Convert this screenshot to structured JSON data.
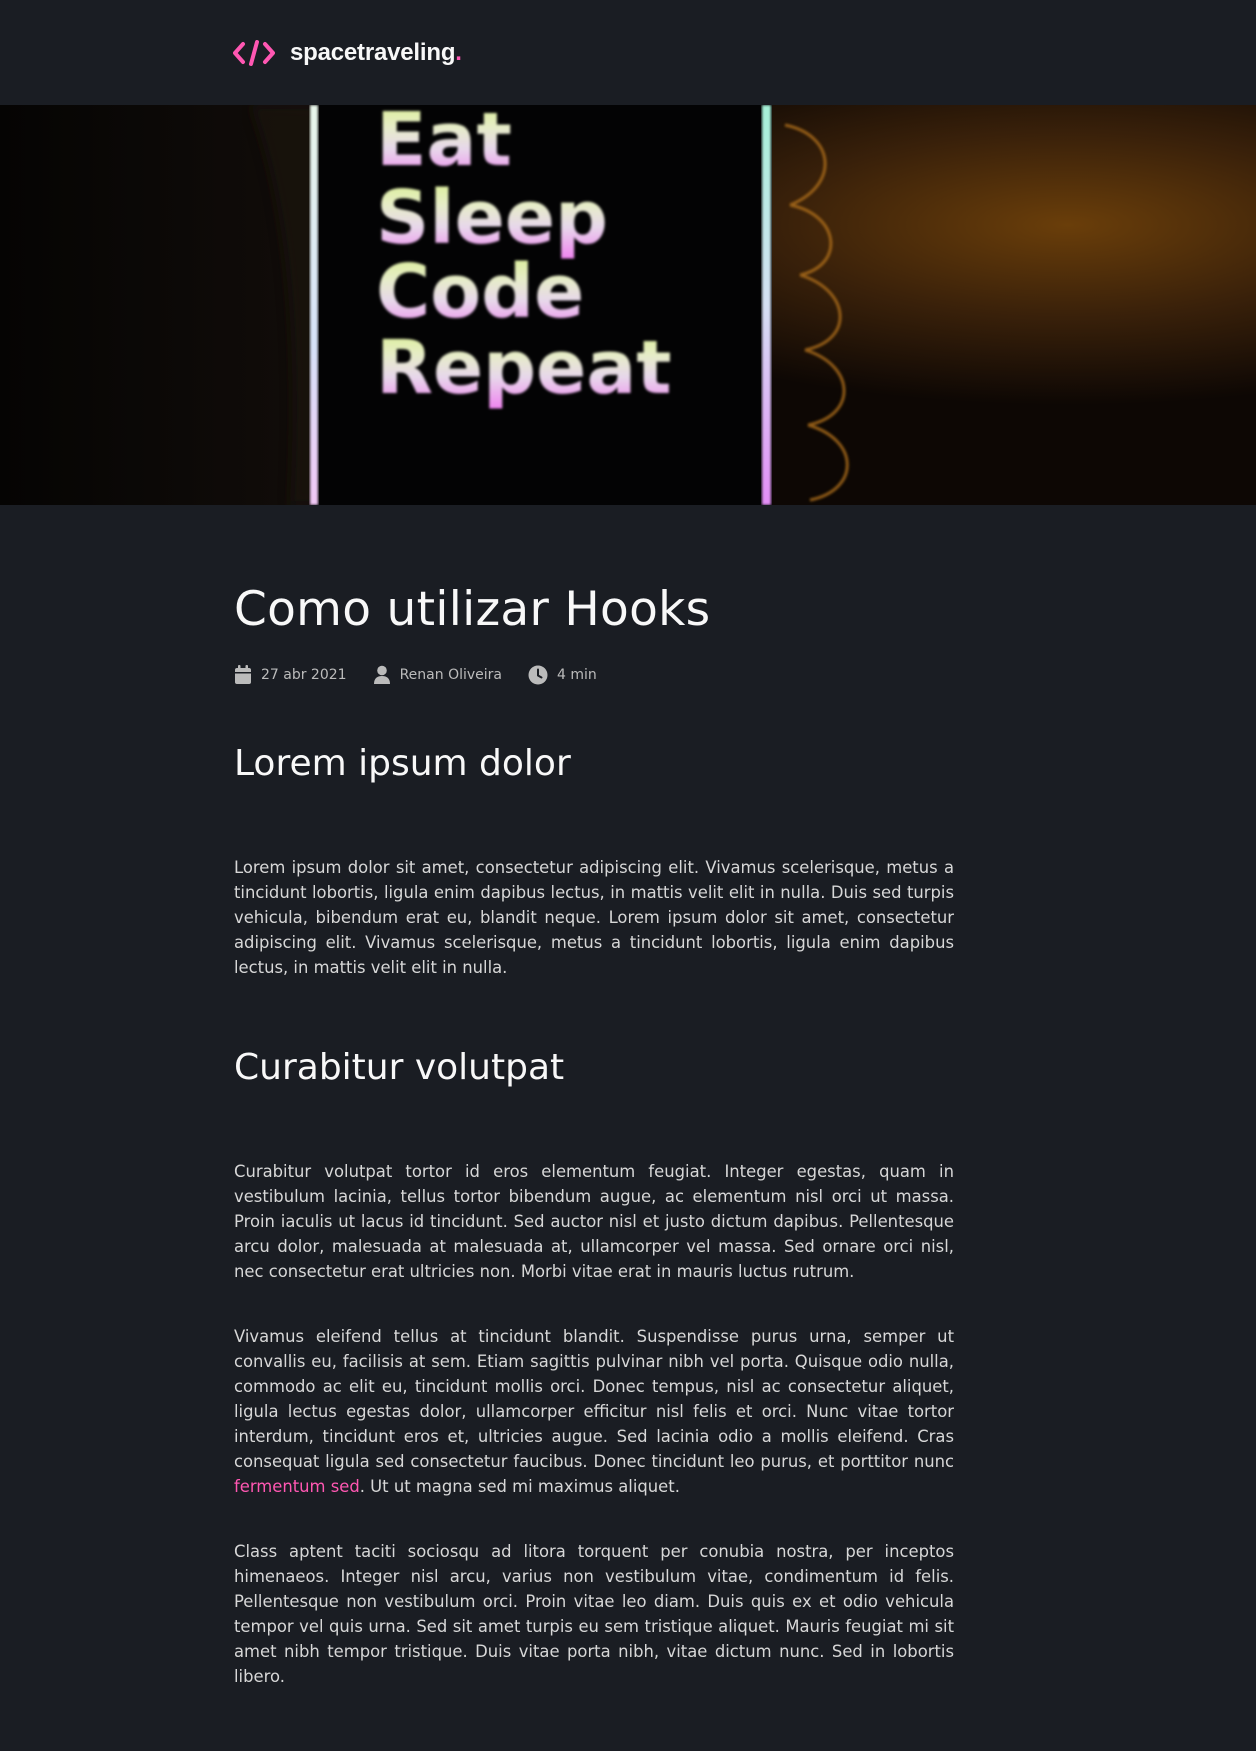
{
  "header": {
    "logo_text": "spacetraveling",
    "logo_dot": ".",
    "accent_color": "#ff57b2",
    "logo_icon": "code-icon"
  },
  "banner": {
    "lines": [
      "Eat",
      "Sleep",
      "Code",
      "Repeat"
    ]
  },
  "post": {
    "title": "Como utilizar Hooks",
    "date": "27 abr 2021",
    "author": "Renan Oliveira",
    "reading_time": "4 min",
    "icons": [
      "calendar-icon",
      "user-icon",
      "clock-icon"
    ],
    "sections": [
      {
        "heading": "Lorem ipsum dolor",
        "paragraphs": [
          {
            "text": "Lorem ipsum dolor sit amet, consectetur adipiscing elit. Vivamus scelerisque, metus a tincidunt lobortis, ligula enim dapibus lectus, in mattis velit elit in nulla. Duis sed turpis vehicula, bibendum erat eu, blandit neque. Lorem ipsum dolor sit amet, consectetur adipiscing elit. Vivamus scelerisque, metus a tincidunt lobortis, ligula enim dapibus lectus, in mattis velit elit in nulla."
          }
        ]
      },
      {
        "heading": "Curabitur volutpat",
        "paragraphs": [
          {
            "text": "Curabitur volutpat tortor id eros elementum feugiat. Integer egestas, quam in vestibulum lacinia, tellus tortor bibendum augue, ac elementum nisl orci ut massa. Proin iaculis ut lacus id tincidunt. Sed auctor nisl et justo dictum dapibus. Pellentesque arcu dolor, malesuada at malesuada at, ullamcorper vel massa. Sed ornare orci nisl, nec consectetur erat ultricies non. Morbi vitae erat in mauris luctus rutrum."
          },
          {
            "text_before": "Vivamus eleifend tellus at tincidunt blandit. Suspendisse purus urna, semper ut convallis eu, facilisis at sem. Etiam sagittis pulvinar nibh vel porta. Quisque odio nulla, commodo ac elit eu, tincidunt mollis orci. Donec tempus, nisl ac consectetur aliquet, ligula lectus egestas dolor, ullamcorper efficitur nisl felis et orci. Nunc vitae tortor interdum, tincidunt eros et, ultricies augue. Sed lacinia odio a mollis eleifend. Cras consequat ligula sed consectetur faucibus. Donec tincidunt leo purus, et porttitor nunc ",
            "link_text": "fermentum sed",
            "text_after": ". Ut ut magna sed mi maximus aliquet."
          },
          {
            "text": "Class aptent taciti sociosqu ad litora torquent per conubia nostra, per inceptos himenaeos. Integer nisl arcu, varius non vestibulum vitae, condimentum id felis. Pellentesque non vestibulum orci. Proin vitae leo diam. Duis quis ex et odio vehicula tempor vel quis urna. Sed sit amet turpis eu sem tristique aliquet. Mauris feugiat mi sit amet nibh tempor tristique. Duis vitae porta nibh, vitae dictum nunc. Sed in lobortis libero."
          }
        ]
      }
    ]
  }
}
